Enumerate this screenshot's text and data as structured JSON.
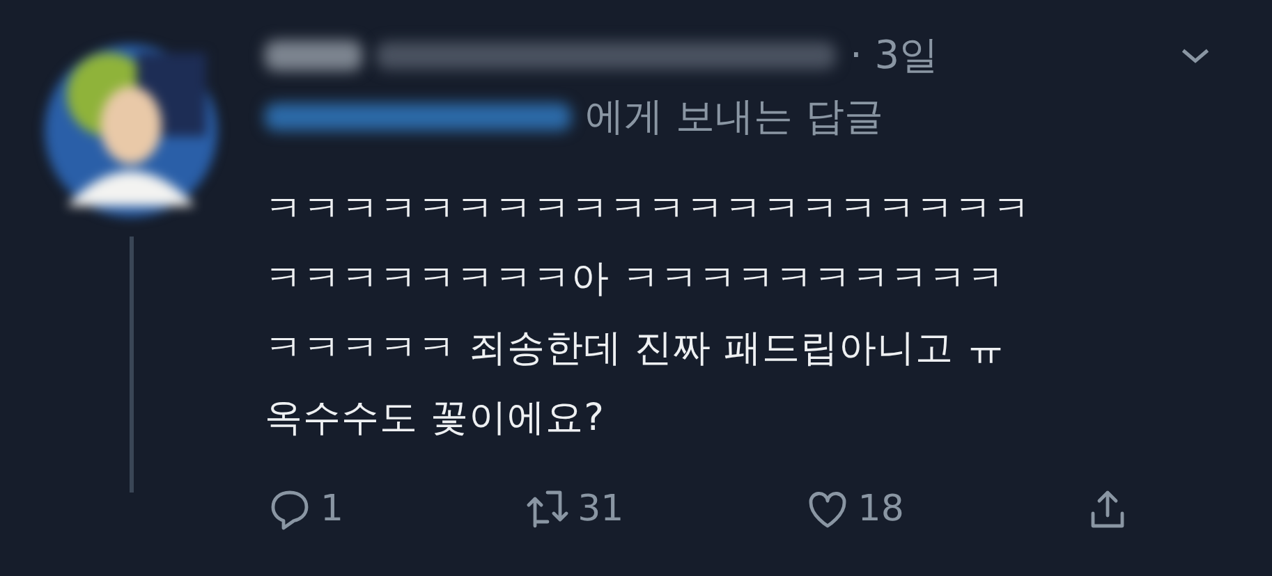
{
  "tweet": {
    "time": "· 3일",
    "reply_to": "에게 보내는 답글",
    "body_lines": [
      "ㅋㅋㅋㅋㅋㅋㅋㅋㅋㅋㅋㅋㅋㅋㅋㅋㅋㅋㅋㅋ",
      "ㅋㅋㅋㅋㅋㅋㅋㅋ아 ㅋㅋㅋㅋㅋㅋㅋㅋㅋㅋ",
      "ㅋㅋㅋㅋㅋ 죄송한데 진짜 패드립아니고 ㅠ",
      "옥수수도 꽃이에요?"
    ],
    "actions": [
      {
        "kind": "reply",
        "count": "1"
      },
      {
        "kind": "retweet",
        "count": "31"
      },
      {
        "kind": "like",
        "count": "18"
      },
      {
        "kind": "share"
      }
    ]
  }
}
